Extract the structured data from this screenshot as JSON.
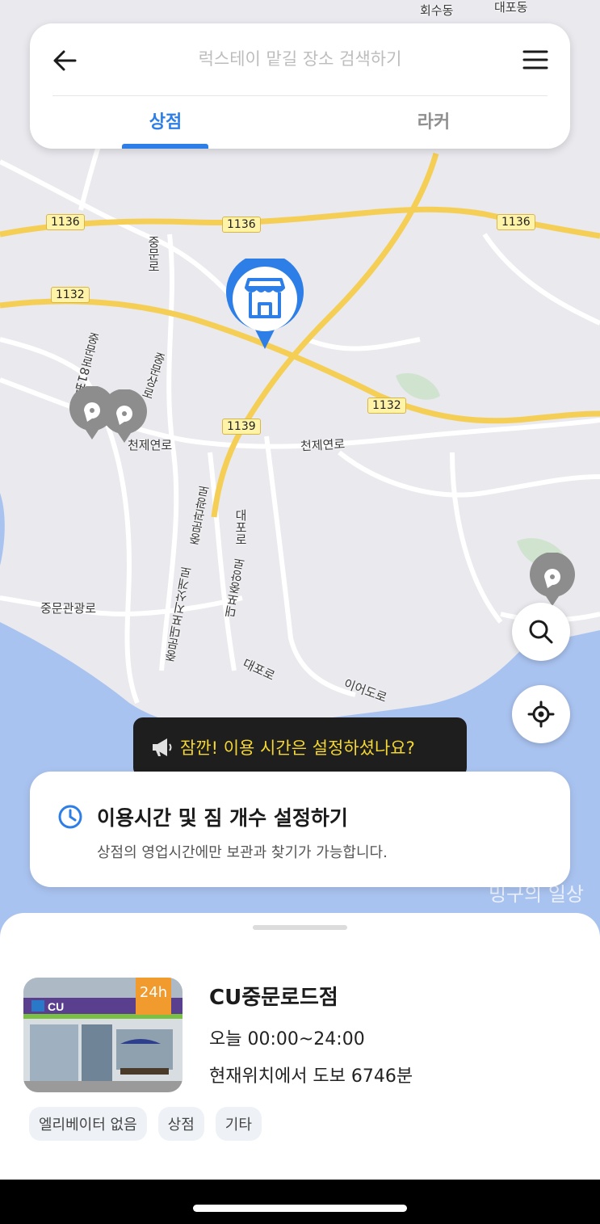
{
  "header": {
    "search_placeholder": "럭스테이 맡길 장소 검색하기",
    "tabs": [
      {
        "label": "상점",
        "active": true
      },
      {
        "label": "라커",
        "active": false
      }
    ]
  },
  "map": {
    "place_labels": [
      "회수동",
      "대포동",
      "중문로",
      "중문로81번길",
      "중문상로",
      "천제연로",
      "천제연로",
      "중문관광로",
      "중문관광로",
      "대포로",
      "중문대포지삿개로",
      "대포중앙로",
      "대포로",
      "이어도로"
    ],
    "route_numbers": [
      "1136",
      "1136",
      "1136",
      "1132",
      "1132",
      "1139"
    ],
    "watermark": "밍구의 일상"
  },
  "tooltip": {
    "text": "잠깐! 이용 시간은 설정하셨나요?"
  },
  "time_card": {
    "title": "이용시간 및 짐 개수 설정하기",
    "subtitle": "상점의 영업시간에만 보관과 찾기가 가능합니다."
  },
  "store": {
    "badge": "24h",
    "name": "CU중문로드점",
    "hours": "오늘 00:00~24:00",
    "distance": "현재위치에서 도보 6746분",
    "tags": [
      "엘리베이터 없음",
      "상점",
      "기타"
    ]
  },
  "colors": {
    "accent": "#2e7ee8",
    "tooltip_text": "#f5d733",
    "badge": "#f19a2e",
    "sea": "#a9c3f0"
  }
}
